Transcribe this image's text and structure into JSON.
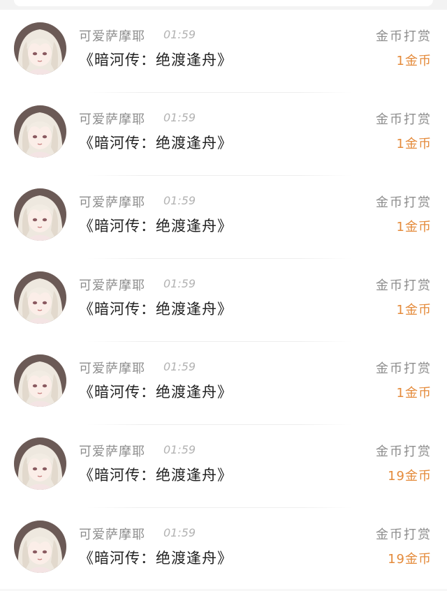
{
  "rewards": [
    {
      "username": "可爱萨摩耶",
      "time": "01:59",
      "title": "《暗河传：绝渡逢舟》",
      "action": "金币打赏",
      "amount": "1金币"
    },
    {
      "username": "可爱萨摩耶",
      "time": "01:59",
      "title": "《暗河传：绝渡逢舟》",
      "action": "金币打赏",
      "amount": "1金币"
    },
    {
      "username": "可爱萨摩耶",
      "time": "01:59",
      "title": "《暗河传：绝渡逢舟》",
      "action": "金币打赏",
      "amount": "1金币"
    },
    {
      "username": "可爱萨摩耶",
      "time": "01:59",
      "title": "《暗河传：绝渡逢舟》",
      "action": "金币打赏",
      "amount": "1金币"
    },
    {
      "username": "可爱萨摩耶",
      "time": "01:59",
      "title": "《暗河传：绝渡逢舟》",
      "action": "金币打赏",
      "amount": "1金币"
    },
    {
      "username": "可爱萨摩耶",
      "time": "01:59",
      "title": "《暗河传：绝渡逢舟》",
      "action": "金币打赏",
      "amount": "19金币"
    },
    {
      "username": "可爱萨摩耶",
      "time": "01:59",
      "title": "《暗河传：绝渡逢舟》",
      "action": "金币打赏",
      "amount": "19金币"
    }
  ],
  "colors": {
    "amount": "#e48a3a",
    "muted_text": "#8d8d8d",
    "title_text": "#222222"
  },
  "icons": {
    "avatar": "anime-girl-avatar"
  }
}
